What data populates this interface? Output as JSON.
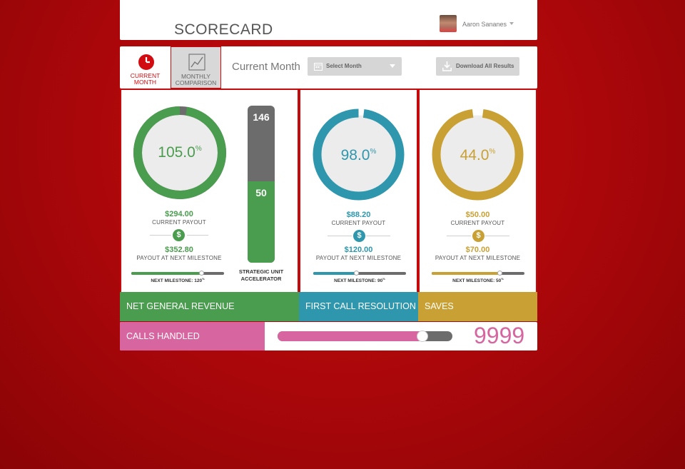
{
  "header": {
    "title": "SCORECARD",
    "user_name": "Aaron Sananes"
  },
  "toolbar": {
    "tab_current": "CURRENT MONTH",
    "tab_monthly": "MONTHLY COMPARISON",
    "view_label": "Current Month",
    "select_placeholder": "Select Month",
    "download_label": "Download All Results"
  },
  "colors": {
    "background": "#b0080b",
    "green": "#4a9c4e",
    "teal": "#2e97ad",
    "gold": "#c9a034",
    "pink": "#d766a0",
    "gray": "#6c6c6c"
  },
  "cards": [
    {
      "id": "ngr",
      "title": "NET GENERAL REVENUE",
      "percent": "105.0",
      "percent_suffix": "%",
      "progress": 1.0,
      "current_payout": "$294.00",
      "current_payout_label": "CURRENT PAYOUT",
      "next_payout": "$352.80",
      "next_payout_label": "PAYOUT AT NEXT MILESTONE",
      "next_milestone_label": "NEXT MILESTONE: 120",
      "next_milestone_suffix": "%",
      "milestone_progress": 0.75,
      "color": "#4a9c4e"
    },
    {
      "id": "fcr",
      "title": "FIRST CALL RESOLUTION",
      "percent": "98.0",
      "percent_suffix": "%",
      "progress": 0.98,
      "current_payout": "$88.20",
      "current_payout_label": "CURRENT PAYOUT",
      "next_payout": "$120.00",
      "next_payout_label": "PAYOUT AT NEXT MILESTONE",
      "next_milestone_label": "NEXT MILESTONE: 90",
      "next_milestone_suffix": "%",
      "milestone_progress": 0.46,
      "color": "#2e97ad"
    },
    {
      "id": "saves",
      "title": "SAVES",
      "percent": "44.0",
      "percent_suffix": "%",
      "progress": 0.96,
      "current_payout": "$50.00",
      "current_payout_label": "CURRENT PAYOUT",
      "next_payout": "$70.00",
      "next_payout_label": "PAYOUT AT NEXT MILESTONE",
      "next_milestone_label": "NEXT MILESTONE: 50",
      "next_milestone_suffix": "%",
      "milestone_progress": 0.73,
      "color": "#c9a034"
    }
  ],
  "accelerator": {
    "max": "146",
    "current": "50",
    "fill_fraction": 0.52,
    "label_line1": "STRATEGIC UNIT",
    "label_line2": "ACCELERATOR"
  },
  "calls": {
    "label": "CALLS HANDLED",
    "value": "9999",
    "progress": 0.83
  }
}
